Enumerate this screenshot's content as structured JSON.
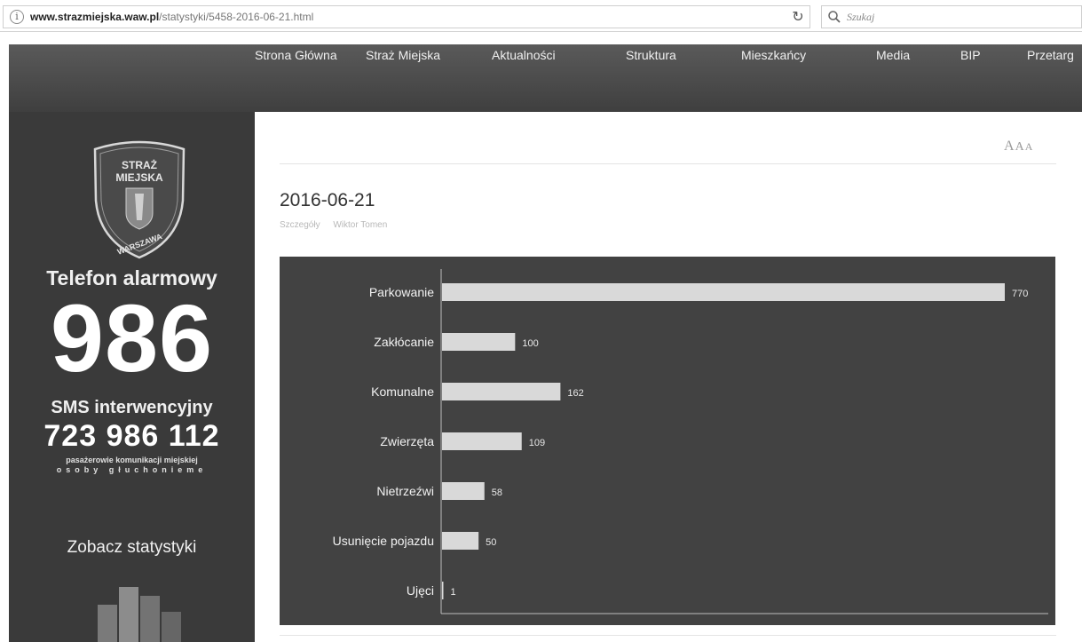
{
  "browser": {
    "url_domain": "www.strazmiejska.waw.pl",
    "url_path": "/statystyki/5458-2016-06-21.html",
    "search_placeholder": "Szukaj"
  },
  "nav": {
    "items": [
      "Strona Główna",
      "Straż Miejska",
      "Aktualności",
      "Struktura",
      "Mieszkańcy",
      "Media",
      "BIP",
      "Przetarg"
    ]
  },
  "sidebar": {
    "logo_text_top": "STRAŻ MIEJSKA",
    "logo_text_bottom": "WARSZAWA",
    "alarm_label": "Telefon alarmowy",
    "alarm_number": "986",
    "sms_label": "SMS interwencyjny",
    "sms_number": "723 986 112",
    "sms_note_line1": "pasażerowie komunikacji miejskiej",
    "sms_note_line2": "osoby głuchonieme",
    "stats_link": "Zobacz statystyki"
  },
  "content": {
    "font_sizer": "A A A",
    "title": "2016-06-21",
    "meta_category": "Szczegóły",
    "meta_author": "Wiktor Tomen"
  },
  "colors": {
    "nav_bg": "#4a4a4a",
    "sidebar_bg": "#3a3a3a",
    "chart_bg": "#424242",
    "bar": "#d9d9d9"
  },
  "chart_data": {
    "type": "bar",
    "orientation": "horizontal",
    "categories": [
      "Parkowanie",
      "Zakłócanie",
      "Komunalne",
      "Zwierzęta",
      "Nietrzeźwi",
      "Usunięcie pojazdu",
      "Ujęci"
    ],
    "values": [
      770,
      100,
      162,
      109,
      58,
      50,
      1
    ],
    "xlim": [
      0,
      770
    ]
  }
}
